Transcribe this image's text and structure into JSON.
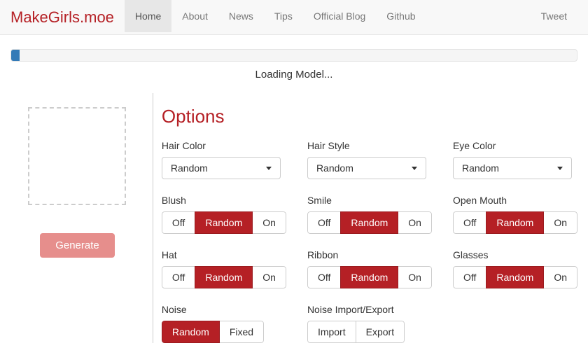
{
  "brand": "MakeGirls.moe",
  "nav": {
    "items": [
      "Home",
      "About",
      "News",
      "Tips",
      "Official Blog",
      "Github"
    ],
    "active_index": 0,
    "right": "Tweet"
  },
  "loading_text": "Loading Model...",
  "generate_label": "Generate",
  "options_title": "Options",
  "labels": {
    "hair_color": "Hair Color",
    "hair_style": "Hair Style",
    "eye_color": "Eye Color",
    "blush": "Blush",
    "smile": "Smile",
    "open_mouth": "Open Mouth",
    "hat": "Hat",
    "ribbon": "Ribbon",
    "glasses": "Glasses",
    "noise": "Noise",
    "noise_io": "Noise Import/Export"
  },
  "dropdown_value": "Random",
  "toggle": {
    "off": "Off",
    "random": "Random",
    "on": "On"
  },
  "noise_toggle": {
    "random": "Random",
    "fixed": "Fixed"
  },
  "io": {
    "import": "Import",
    "export": "Export"
  }
}
